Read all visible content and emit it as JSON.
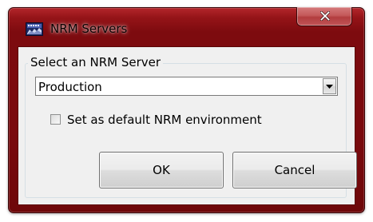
{
  "window": {
    "title": "NRM Servers",
    "app_icon": "nrm-app-icon",
    "close_icon": "close-icon",
    "frame_color": "#7d0b0f"
  },
  "group": {
    "legend": "Select an NRM Server"
  },
  "server_select": {
    "selected": "Production",
    "icon": "chevron-down-icon"
  },
  "default_checkbox": {
    "label": "Set as default NRM environment",
    "checked": false
  },
  "buttons": {
    "ok": "OK",
    "cancel": "Cancel"
  }
}
